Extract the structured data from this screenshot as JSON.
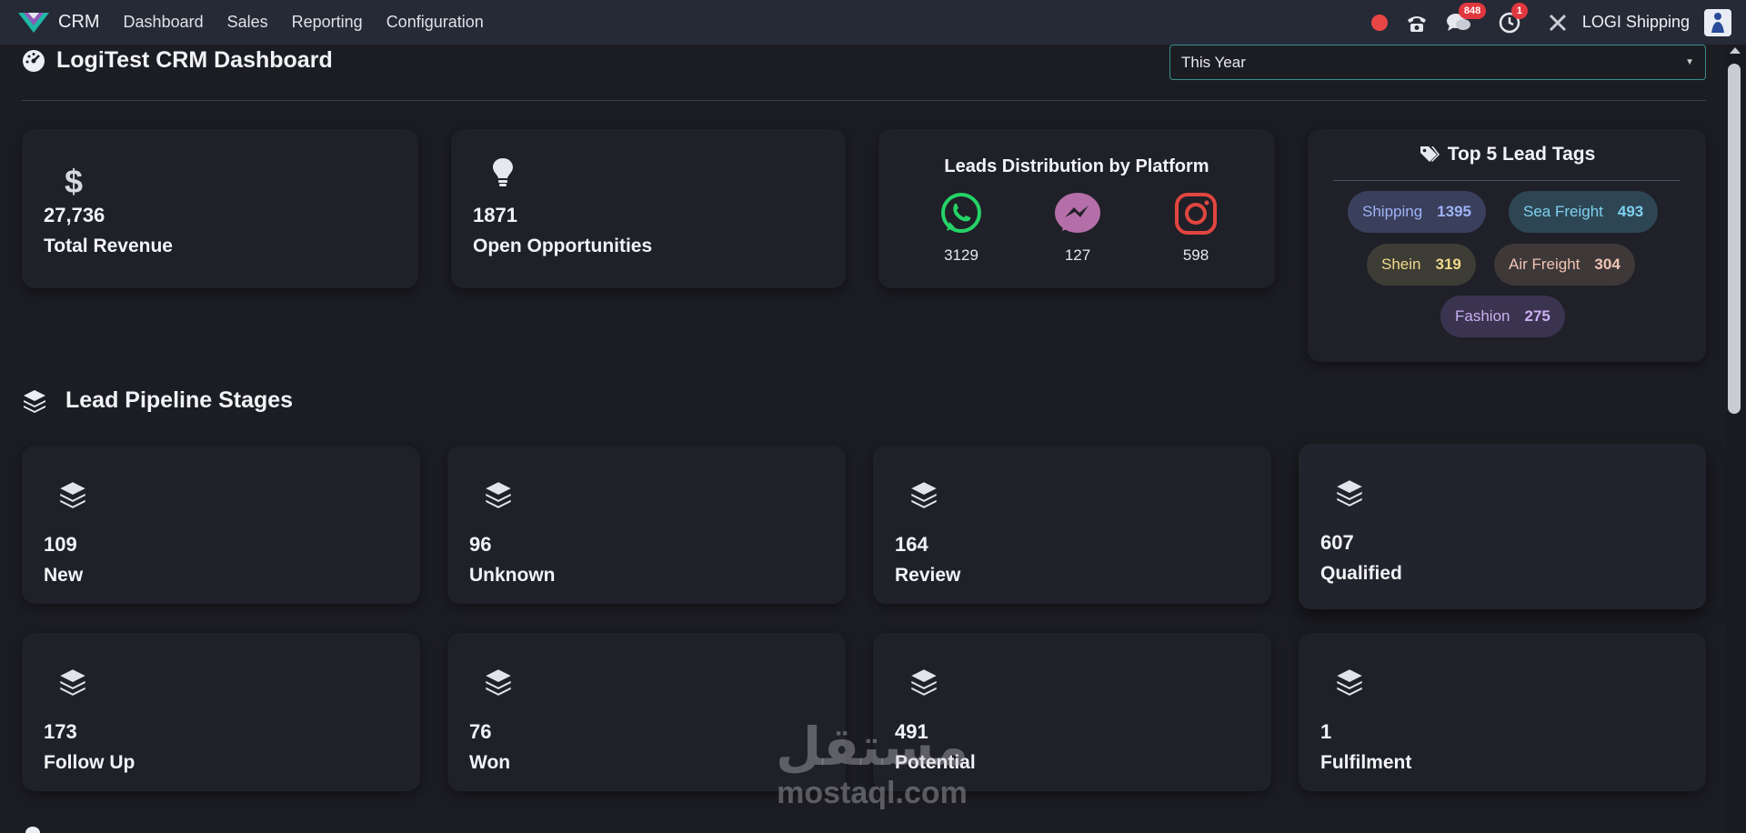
{
  "nav": {
    "app_name": "CRM",
    "items": [
      "Dashboard",
      "Sales",
      "Reporting",
      "Configuration"
    ],
    "message_count": "848",
    "activity_count": "1",
    "company": "LOGI Shipping"
  },
  "header": {
    "title": "LogiTest CRM Dashboard",
    "period": "This Year"
  },
  "kpis": [
    {
      "icon": "dollar-icon",
      "value": "27,736",
      "label": "Total Revenue"
    },
    {
      "icon": "lightbulb-icon",
      "value": "1871",
      "label": "Open Opportunities"
    }
  ],
  "platforms": {
    "title": "Leads Distribution by Platform",
    "items": [
      {
        "icon": "whatsapp-icon",
        "count": "3129",
        "color": "#25d366"
      },
      {
        "icon": "messenger-icon",
        "count": "127",
        "color": "#b56fa8"
      },
      {
        "icon": "instagram-icon",
        "count": "598",
        "color": "#e0463f"
      }
    ]
  },
  "tags": {
    "title": "Top 5 Lead Tags",
    "items": [
      {
        "name": "Shipping",
        "count": "1395",
        "bg": "#3a3f5c",
        "fg": "#9eb3f5"
      },
      {
        "name": "Sea Freight",
        "count": "493",
        "bg": "#2e4654",
        "fg": "#7fd0f0"
      },
      {
        "name": "Shein",
        "count": "319",
        "bg": "#3d3d35",
        "fg": "#f1d98a"
      },
      {
        "name": "Air Freight",
        "count": "304",
        "bg": "#3f3838",
        "fg": "#f0c5b5"
      },
      {
        "name": "Fashion",
        "count": "275",
        "bg": "#3a3450",
        "fg": "#c9b0f0"
      }
    ]
  },
  "pipeline": {
    "title": "Lead Pipeline Stages",
    "stages": [
      {
        "value": "109",
        "label": "New"
      },
      {
        "value": "96",
        "label": "Unknown"
      },
      {
        "value": "164",
        "label": "Review"
      },
      {
        "value": "607",
        "label": "Qualified"
      },
      {
        "value": "173",
        "label": "Follow Up"
      },
      {
        "value": "76",
        "label": "Won"
      },
      {
        "value": "491",
        "label": "Potential"
      },
      {
        "value": "1",
        "label": "Fulfilment"
      }
    ]
  },
  "watermark": {
    "arabic": "مستقل",
    "latin": "mostaql.com"
  },
  "colors": {
    "background": "#1c1d23",
    "topbar": "#262a36",
    "card": "#1f2028",
    "accent": "#3a8f8a"
  }
}
